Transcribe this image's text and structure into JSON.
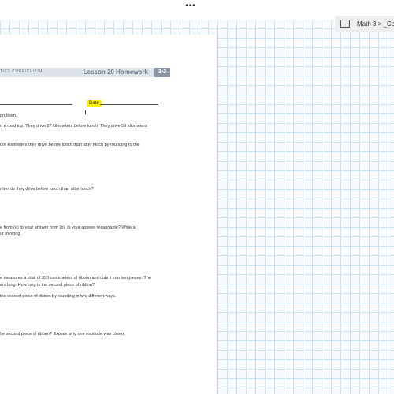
{
  "toolbar": {
    "more_icon": "ellipsis-icon",
    "more_glyph": "•••"
  },
  "breadcrumb": {
    "icon": "page-icon",
    "text": "Math 3 >  _Co"
  },
  "page": {
    "curriculum": "TICS CURRICULUM",
    "lesson_title": "Lesson 20 Homework",
    "lesson_number": "3•2",
    "date_label": "Date",
    "lines": [
      "problem.",
      "n a road trip.  They drive 87 kilometers before lunch.  They drive 59 kilometers",
      "ore kilometers they drive before lunch than after lunch by rounding to the",
      "rther do they drive before lunch than after lunch?",
      "e from (a) to your answer from (b).  Is your answer reasonable?  Write a",
      "ur thinking.",
      "e measures a total of 393 centimeters of ribbon and cuts it into two pieces.  The",
      "ers long.  How long is the second piece of ribbon?",
      " the second piece of ribbon by rounding in two different ways.",
      "he second piece of ribbon?  Explain why one estimate was closer."
    ]
  },
  "colors": {
    "highlight": "#fff200",
    "band": "#dde3e9",
    "grid": "#cde3f3"
  }
}
